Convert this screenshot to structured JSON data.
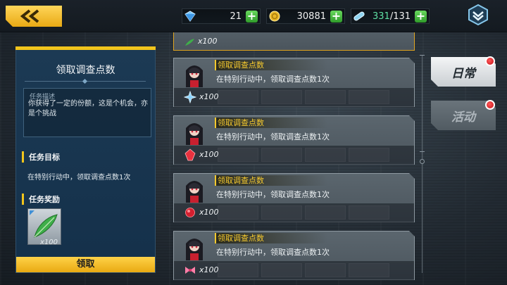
{
  "topbar": {
    "resources": [
      {
        "icon": "blue-gem-icon",
        "value": "21"
      },
      {
        "icon": "gold-coin-icon",
        "value": "30881"
      },
      {
        "icon": "stamina-capsule-icon",
        "value_current": "331",
        "value_max": "/131"
      }
    ]
  },
  "left_panel": {
    "title": "领取调查点数",
    "description_label": "任务描述",
    "description": "你获得了一定的份额，这是个机会，亦是个挑战",
    "objective_heading": "任务目标",
    "objective_text": "在特别行动中，领取调查点数1次",
    "reward_heading": "任务奖励",
    "reward_item": {
      "icon": "green-feather-icon",
      "qty": "x100"
    },
    "claim_button": "领取"
  },
  "task_list": {
    "top_partial_qty": "x100",
    "tasks": [
      {
        "title": "领取调查点数",
        "description": "在特别行动中，领取调查点数1次",
        "reward_icon": "blue-star-crystal-icon",
        "reward_qty": "x100"
      },
      {
        "title": "领取调查点数",
        "description": "在特别行动中，领取调查点数1次",
        "reward_icon": "red-crystal-icon",
        "reward_qty": "x100"
      },
      {
        "title": "领取调查点数",
        "description": "在特别行动中，领取调查点数1次",
        "reward_icon": "red-gem-icon",
        "reward_qty": "x100"
      },
      {
        "title": "领取调查点数",
        "description": "在特别行动中，领取调查点数1次",
        "reward_icon": "pink-bow-icon",
        "reward_qty": "x100"
      }
    ]
  },
  "side_tabs": [
    {
      "label": "日常",
      "active": true,
      "badge": true
    },
    {
      "label": "活动",
      "active": false,
      "badge": true
    }
  ],
  "colors": {
    "accent": "#f2c51c",
    "panel": "#1c3a54",
    "plus": "#3fb23a",
    "badge": "#d8141c"
  }
}
